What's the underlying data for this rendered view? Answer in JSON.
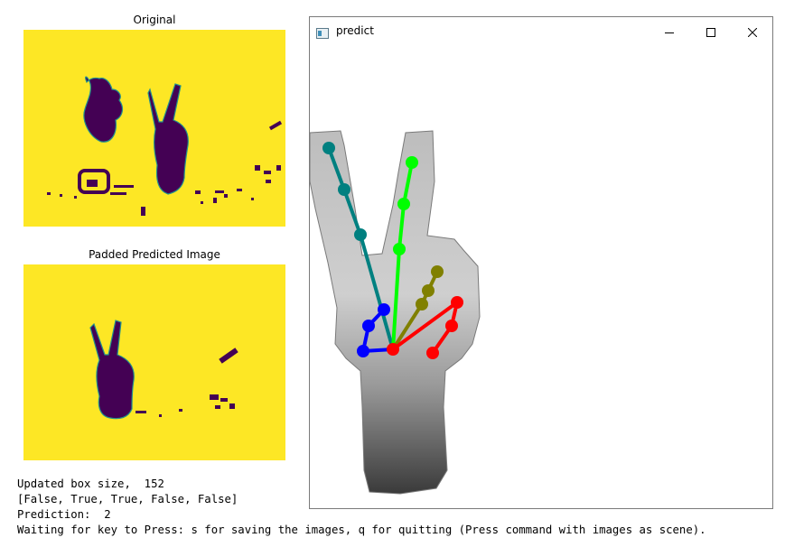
{
  "panels": {
    "original": {
      "title": "Original"
    },
    "padded": {
      "title": "Padded Predicted Image"
    }
  },
  "console": {
    "lines": [
      "Updated box size,  152",
      "[False, True, True, False, False]",
      "Prediction:  2",
      "Waiting for key to Press: s for saving the images, q for quitting (Press command with images as scene)."
    ]
  },
  "window": {
    "title": "predict",
    "icons": {
      "app": "app-window-icon",
      "minimize": "minimize-icon",
      "maximize": "maximize-icon",
      "close": "close-icon"
    }
  },
  "colors": {
    "plot_background": "#fde725",
    "blob": "#440154",
    "edge_teal": "#21918c",
    "finger_teal": "#008080",
    "finger_green": "#00ff00",
    "finger_olive": "#808000",
    "finger_red": "#ff0000",
    "finger_blue": "#0000ff"
  }
}
